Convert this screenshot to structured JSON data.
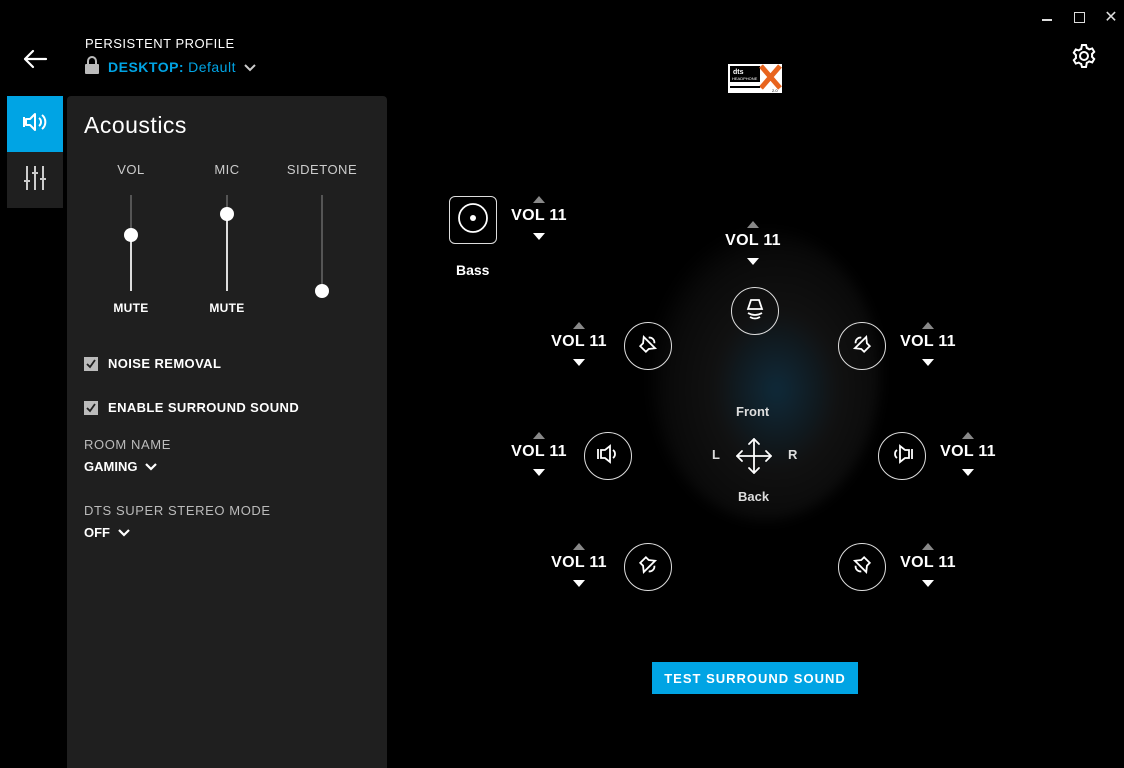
{
  "window": {
    "minimize": "",
    "maximize": "",
    "close": "✕"
  },
  "header": {
    "profile_label": "PERSISTENT PROFILE",
    "profile_device": "DESKTOP:",
    "profile_name": "Default"
  },
  "panel": {
    "title": "Acoustics",
    "sliders": [
      {
        "label": "VOL",
        "mute": "MUTE",
        "level": 0.58
      },
      {
        "label": "MIC",
        "mute": "MUTE",
        "level": 0.8
      },
      {
        "label": "SIDETONE",
        "mute": "",
        "level": 0.0
      }
    ],
    "noise_removal": {
      "label": "NOISE REMOVAL",
      "checked": true
    },
    "surround": {
      "label": "ENABLE SURROUND SOUND",
      "checked": true
    },
    "room_name": {
      "label": "ROOM NAME",
      "value": "GAMING"
    },
    "dts_mode": {
      "label": "DTS SUPER STEREO MODE",
      "value": "OFF"
    }
  },
  "surround": {
    "bass_label": "Bass",
    "front_label": "Front",
    "back_label": "Back",
    "left_label": "L",
    "right_label": "R",
    "volumes": {
      "bass": "VOL 11",
      "center": "VOL 11",
      "front_left": "VOL 11",
      "front_right": "VOL 11",
      "side_left": "VOL 11",
      "side_right": "VOL 11",
      "rear_left": "VOL 11",
      "rear_right": "VOL 11"
    },
    "test_button": "TEST SURROUND SOUND"
  },
  "colors": {
    "accent": "#00a4e4",
    "panel": "#1f1f1f",
    "background": "#000000"
  }
}
